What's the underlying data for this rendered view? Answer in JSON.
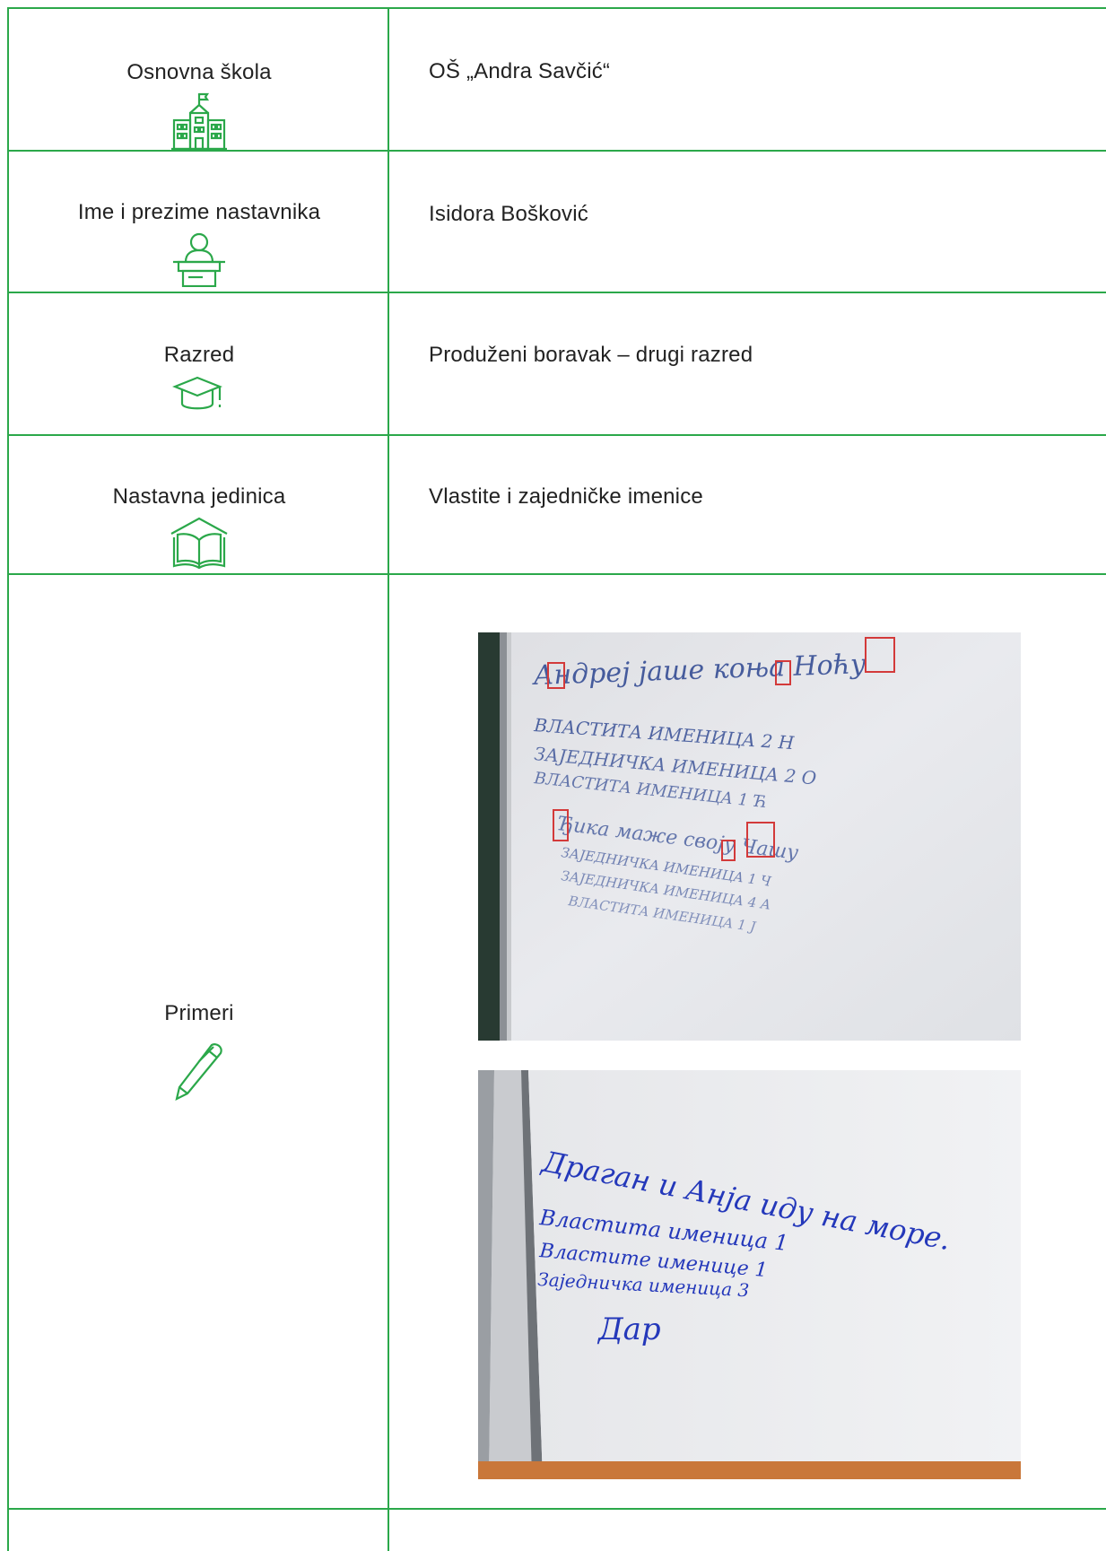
{
  "rows": [
    {
      "label": "Osnovna škola",
      "value": "OŠ „Andra Savčić“",
      "icon": "school-building-icon"
    },
    {
      "label": "Ime i prezime nastavnika",
      "value": "Isidora Bošković",
      "icon": "teacher-at-desk-icon"
    },
    {
      "label": "Razred",
      "value": "Produženi boravak – drugi razred",
      "icon": "graduation-cap-icon"
    },
    {
      "label": "Nastavna jedinica",
      "value": "Vlastite i zajedničke imenice",
      "icon": "open-book-icon"
    },
    {
      "label": "Primeri",
      "icon": "pen-icon"
    }
  ],
  "photos": [
    {
      "name": "whiteboard-photo-1",
      "lines": [
        {
          "text": "Андреј јаше коња Ноћу",
          "color": "#1f3a8a"
        },
        {
          "text": "ВЛАСТИТА  ИМЕНИЦА   2   Н",
          "color": "#1f3a8a"
        },
        {
          "text": "ЗАЈЕДНИЧКА  ИМЕНИЦА   2   О",
          "color": "#1f3a8a"
        },
        {
          "text": "ВЛАСТИТА   ИМЕНИЦА   1   Ћ",
          "color": "#1f3a8a"
        },
        {
          "text": "Ђика маже своју Чашу",
          "color": "#1f3a8a"
        },
        {
          "text": "ЗАЈЕДНИЧКА ИМЕНИЦА  1  Ч",
          "color": "#1f3a8a"
        },
        {
          "text": "ЗАЈЕДНИЧКА ИМЕНИЦА  4  А",
          "color": "#1f3a8a"
        },
        {
          "text": "ВЛАСТИТА   ИМЕНИЦА  1  Ј",
          "color": "#1f3a8a"
        }
      ]
    },
    {
      "name": "whiteboard-photo-2",
      "lines": [
        {
          "text": "Драган и Анја иду на море.",
          "color": "#1a2fb8"
        },
        {
          "text": "Властита именица 1",
          "color": "#1a2fb8"
        },
        {
          "text": "Властите именице 1",
          "color": "#1a2fb8"
        },
        {
          "text": "Заједничка именица 3",
          "color": "#1a2fb8"
        },
        {
          "text": "Дар",
          "color": "#1a2fb8"
        }
      ]
    }
  ],
  "colors": {
    "accent": "#2ba84a",
    "text": "#222222"
  }
}
